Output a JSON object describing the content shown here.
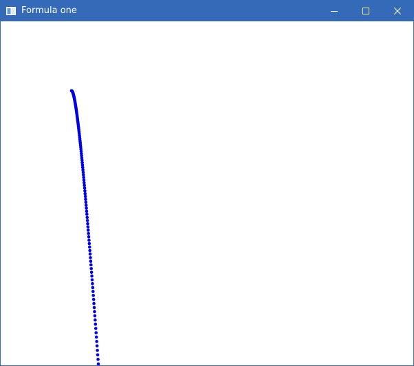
{
  "window": {
    "title": "Formula one",
    "titlebar_color": "#346ab8",
    "icons": {
      "app": "app-window-icon",
      "minimize": "minimize-icon",
      "maximize": "maximize-icon",
      "close": "close-icon"
    }
  },
  "plot": {
    "point_color": "#0000e6",
    "point_count": 120
  }
}
